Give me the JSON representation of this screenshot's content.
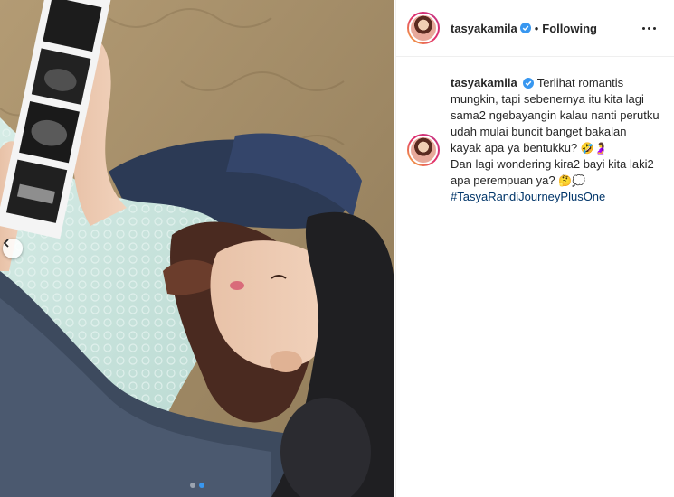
{
  "post": {
    "username": "tasyakamila",
    "follow_status": "Following",
    "separator": "•",
    "caption": {
      "line1": "Terlihat romantis mungkin, tapi sebenernya itu kita lagi sama2 ngebayangin kalau nanti perutku udah mulai buncit banget bakalan kayak apa ya bentukku?",
      "emoji1": "🤣🤰",
      "line2": "Dan lagi wondering kira2 bayi kita laki2 apa perempuan ya?",
      "emoji2": "🤔💭",
      "hashtag": "#TasyaRandiJourneyPlusOne"
    }
  },
  "carousel": {
    "total": 2,
    "active_index": 1
  },
  "colors": {
    "accent": "#3897f0",
    "hashtag": "#003569",
    "verified": "#3897f0"
  },
  "icons": {
    "verified": "verified-badge-icon",
    "prev": "chevron-left-icon",
    "more": "more-options-icon"
  }
}
